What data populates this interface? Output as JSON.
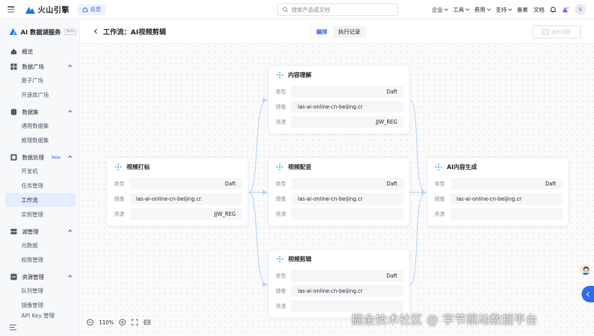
{
  "topbar": {
    "brand": "火山引擎",
    "overview": "总览",
    "search_placeholder": "搜索产品或文档",
    "nav": [
      "企业",
      "工具",
      "费用",
      "支持",
      "备案",
      "文档"
    ],
    "avatar": "S"
  },
  "sidebar": {
    "title": "AI 数据湖服务",
    "badge": "Beta",
    "new_badge": "New",
    "items": [
      {
        "label": "概览"
      },
      {
        "label": "数据广场"
      },
      {
        "label": "算子广场"
      },
      {
        "label": "开源库广场"
      },
      {
        "label": "数据集"
      },
      {
        "label": "通用数据集"
      },
      {
        "label": "推理数据集"
      },
      {
        "label": "数据处理"
      },
      {
        "label": "开发机"
      },
      {
        "label": "任务管理"
      },
      {
        "label": "工作流"
      },
      {
        "label": "实例管理"
      },
      {
        "label": "湖管理"
      },
      {
        "label": "元数据"
      },
      {
        "label": "权限管理"
      },
      {
        "label": "资源管理"
      },
      {
        "label": "队列管理"
      },
      {
        "label": "镜像管理"
      },
      {
        "label": "API Key 管理"
      }
    ]
  },
  "header": {
    "title": "工作流：AI视频剪辑",
    "tabs": [
      "编排",
      "执行记录"
    ],
    "run_button": "画布调度"
  },
  "labels": {
    "type": "类型",
    "image": "镜像",
    "source": "资源"
  },
  "nodes": {
    "tagging": {
      "title": "视频打标",
      "type": "Daft",
      "image": "las-ai-online-cn-beijing.cr.",
      "source": "JJW_REG"
    },
    "understand": {
      "title": "内容理解",
      "type": "Daft",
      "image": "las-ai-online-cn-beijing.cr",
      "source": "JJW_REG"
    },
    "dubbing": {
      "title": "视频配音",
      "type": "Daft",
      "image": "las-ai-online-cn-beijing.cr",
      "source": ""
    },
    "editing": {
      "title": "视频剪辑",
      "type": "Daft",
      "image": "las-ai-online-cn-beijing.cr",
      "source": ""
    },
    "generate": {
      "title": "AI内容生成",
      "type": "Daft",
      "image": "las-ai-online-cn-beijing.cr",
      "source": ""
    }
  },
  "zoom": "110%",
  "watermark": "掘金技术社区 @ 字节跳动数据平台",
  "colors": {
    "accent": "#3b5bdb",
    "edge": "#b8d3f0",
    "node_icon": "#3aa3e3"
  }
}
